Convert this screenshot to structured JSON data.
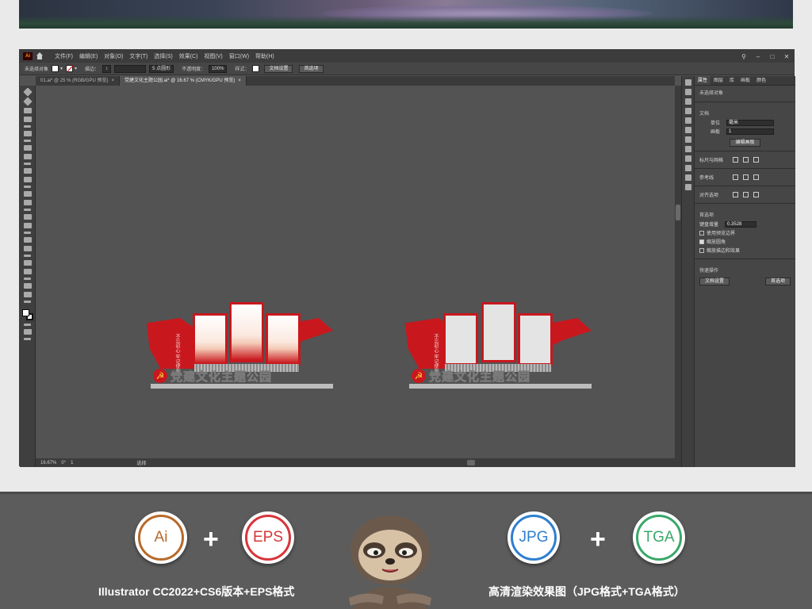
{
  "menu": {
    "app_logo": "Ai",
    "items": [
      "文件(F)",
      "编辑(E)",
      "对象(O)",
      "文字(T)",
      "选择(S)",
      "效果(C)",
      "视图(V)",
      "窗口(W)",
      "帮助(H)"
    ],
    "window_controls": [
      "–",
      "□",
      "✕"
    ]
  },
  "control_bar": {
    "selection_label": "未选择对象",
    "stroke_label": "描边：",
    "stroke_value": "↕",
    "brush_value": "5 点圆形",
    "opacity_label": "不透明度：",
    "opacity_value": "100%",
    "style_label": "样式：",
    "doc_setup_button": "文档设置",
    "prefs_button": "首选项"
  },
  "tabs": [
    {
      "label": "01.ai* @ 25 % (RGB/GPU 预览)",
      "active": false
    },
    {
      "label": "党建文化主题公园.ai* @ 16.67 % (CMYK/GPU 预览)",
      "active": true
    }
  ],
  "canvas": {
    "left_design": {
      "title": "党建文化主题公园",
      "emblem": "☭",
      "flag_text": "不忘初心 牢记使命"
    },
    "right_design": {
      "title": "党建文化主题公园",
      "emblem": "☭",
      "flag_text": "不忘初心 牢记使命"
    }
  },
  "status_bar": {
    "zoom": "16.67%",
    "angle": "0°",
    "artboard": "1",
    "tool": "选择"
  },
  "properties_panel": {
    "tabs": [
      "属性",
      "图层",
      "库",
      "画板",
      "颜色"
    ],
    "no_selection": "未选择对象",
    "document_section": "文档",
    "unit_label": "单位",
    "unit_value": "毫米",
    "artboard_label": "画板",
    "artboard_value": "1",
    "edit_artboards_button": "编辑画板",
    "rulers_label": "标尺与网格",
    "guides_label": "参考线",
    "snap_label": "对齐选项",
    "prefs_section": "首选项",
    "keyboard_increment_label": "键盘增量",
    "keyboard_increment_value": "0.3528",
    "checkboxes": [
      {
        "label": "使用预览边界",
        "checked": false
      },
      {
        "label": "缩放圆角",
        "checked": true
      },
      {
        "label": "缩放描边和效果",
        "checked": false
      }
    ],
    "quick_actions_section": "快速操作",
    "doc_setup_button": "文档设置",
    "prefs_button": "首选项"
  },
  "promo": {
    "badges": [
      {
        "label": "Ai",
        "color": "#b86a2a"
      },
      {
        "label": "EPS",
        "color": "#d8353a"
      },
      {
        "label": "JPG",
        "color": "#2f7fd0"
      },
      {
        "label": "TGA",
        "color": "#3aa86a"
      }
    ],
    "plus": "+",
    "caption_left": "Illustrator CC2022+CS6版本+EPS格式",
    "caption_right": "高清渲染效果图（JPG格式+TGA格式）"
  },
  "colors": {
    "accent_red": "#c8181e",
    "ui_dark": "#3c3c3c",
    "canvas": "#535353"
  }
}
